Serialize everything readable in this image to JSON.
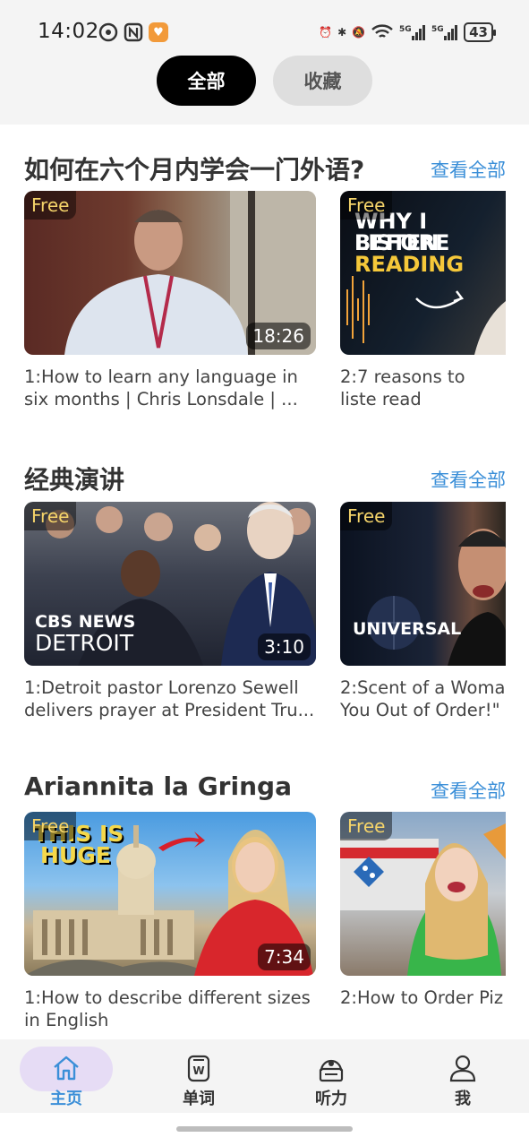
{
  "status": {
    "time": "14:02",
    "battery": "43"
  },
  "segments": {
    "all": "全部",
    "favorites": "收藏"
  },
  "sections": [
    {
      "title": "如何在六个月内学会一门外语?",
      "see_all": "查看全部",
      "cards": [
        {
          "badge": "Free",
          "duration": "18:26",
          "title": "1:How to learn any language in six months | Chris Lonsdale | ..."
        },
        {
          "badge": "Free",
          "thumb_text": [
            "WHY I LISTEN",
            "BEFORE",
            "READING"
          ],
          "title": "2:7 reasons to liste read"
        }
      ]
    },
    {
      "title": "经典演讲",
      "see_all": "查看全部",
      "cards": [
        {
          "badge": "Free",
          "duration": "3:10",
          "thumb_text": [
            "CBS NEWS",
            "DETROIT"
          ],
          "title": "1:Detroit pastor Lorenzo Sewell delivers prayer at President Tru..."
        },
        {
          "badge": "Free",
          "thumb_text": [
            "UNIVERSAL"
          ],
          "title": "2:Scent of a Woma You Out of Order!\""
        }
      ]
    },
    {
      "title": "Ariannita la Gringa",
      "see_all": "查看全部",
      "cards": [
        {
          "badge": "Free",
          "duration": "7:34",
          "thumb_text": [
            "THIS IS",
            "HUGE"
          ],
          "title": "1:How to describe different sizes in English"
        },
        {
          "badge": "Free",
          "title": "2:How to Order Piz"
        }
      ]
    }
  ],
  "tabs": [
    {
      "label": "主页",
      "icon": "home-icon",
      "active": true
    },
    {
      "label": "单词",
      "icon": "word-book-icon",
      "active": false
    },
    {
      "label": "听力",
      "icon": "listening-icon",
      "active": false
    },
    {
      "label": "我",
      "icon": "profile-icon",
      "active": false
    }
  ],
  "colors": {
    "accent": "#3b8fd8",
    "badge_text": "#f5d46a",
    "active_tab_pill": "#e6dcf5"
  }
}
